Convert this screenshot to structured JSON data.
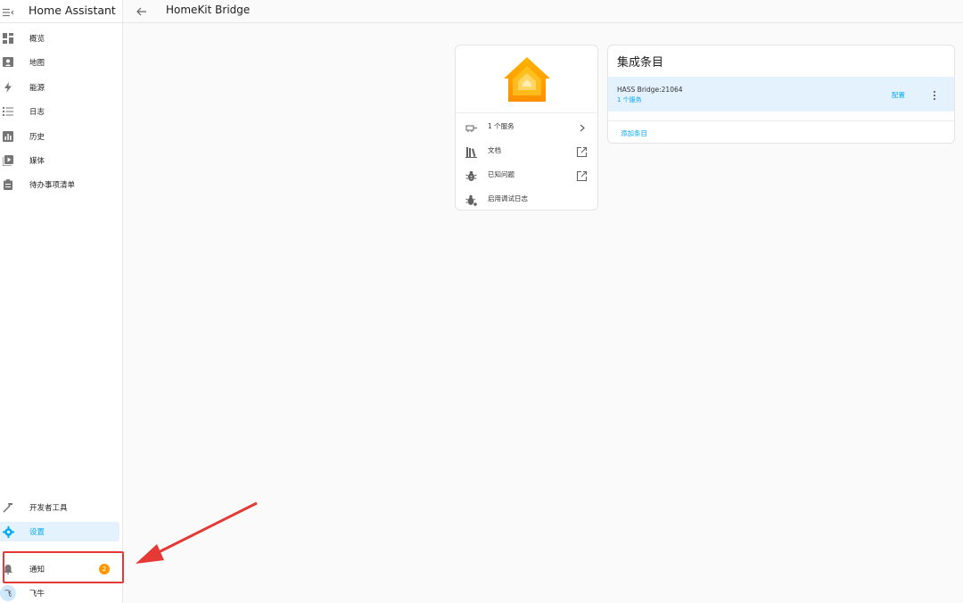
{
  "sidebar": {
    "title": "Home Assistant",
    "items": [
      {
        "label": "概览",
        "icon": "dashboard-icon"
      },
      {
        "label": "地图",
        "icon": "map-icon"
      },
      {
        "label": "能源",
        "icon": "lightning-icon"
      },
      {
        "label": "日志",
        "icon": "list-icon"
      },
      {
        "label": "历史",
        "icon": "chart-icon"
      },
      {
        "label": "媒体",
        "icon": "media-icon"
      },
      {
        "label": "待办事项清单",
        "icon": "clipboard-icon"
      }
    ],
    "bottom": {
      "dev_tools": "开发者工具",
      "settings": "设置",
      "notifications": "通知",
      "notification_count": "2",
      "user": "飞牛",
      "user_initial": "飞"
    }
  },
  "header": {
    "title": "HomeKit Bridge"
  },
  "info_card": {
    "links": [
      {
        "label": "1 个服务",
        "icon": "service-icon",
        "trail": "chevron-right-icon"
      },
      {
        "label": "文档",
        "icon": "book-icon",
        "trail": "open-external-icon"
      },
      {
        "label": "已知问题",
        "icon": "bug-icon",
        "trail": "open-external-icon"
      },
      {
        "label": "启用调试日志",
        "icon": "bug-debug-icon",
        "trail": ""
      }
    ]
  },
  "entries_card": {
    "title": "集成条目",
    "entry": {
      "name": "HASS Bridge:21064",
      "sub": "1 个服务",
      "config": "配置"
    },
    "add": "添加条目"
  },
  "colors": {
    "accent": "#03a9f4",
    "active_bg": "#e3f2fd",
    "badge": "#ff9800",
    "annotation": "#e53935",
    "logo_orange": "#ff9800"
  }
}
